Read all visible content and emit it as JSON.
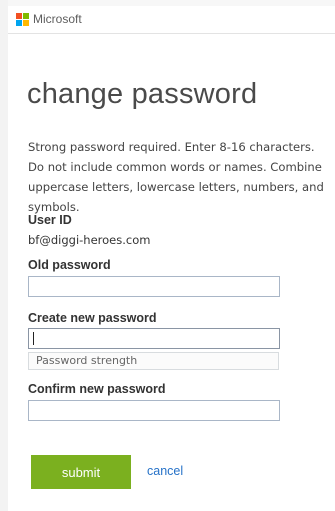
{
  "brand": {
    "name": "Microsoft",
    "logo_colors": [
      "#f25022",
      "#7fba00",
      "#00a4ef",
      "#ffb900"
    ]
  },
  "page": {
    "title": "change password"
  },
  "intro": "Strong password required. Enter 8-16 characters. Do not include common words or names. Combine uppercase letters, lowercase letters, numbers, and symbols.",
  "user": {
    "label": "User ID",
    "value": "bf@diggi-heroes.com"
  },
  "fields": {
    "old_password": {
      "label": "Old password",
      "value": ""
    },
    "new_password": {
      "label": "Create new password",
      "value": "",
      "strength_label": "Password strength"
    },
    "confirm_password": {
      "label": "Confirm new password",
      "value": ""
    }
  },
  "actions": {
    "submit": "submit",
    "cancel": "cancel"
  },
  "colors": {
    "accent": "#7bb01f",
    "link": "#2672c8"
  }
}
